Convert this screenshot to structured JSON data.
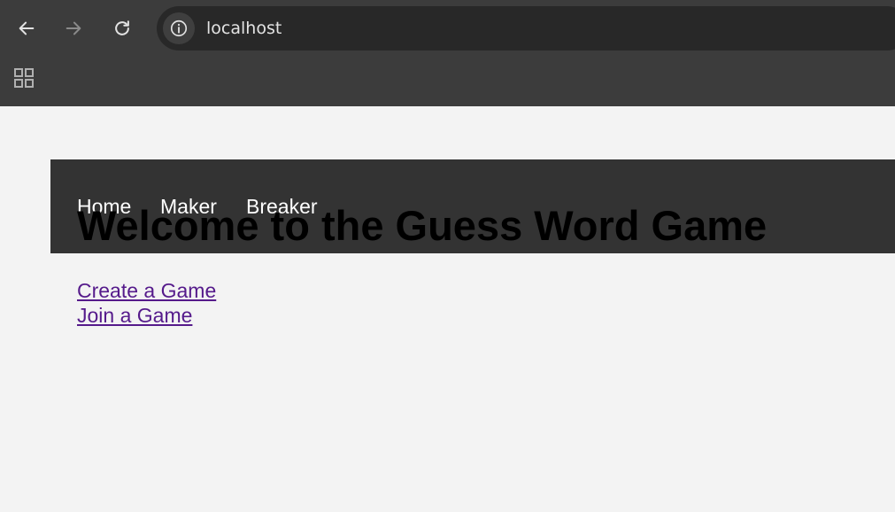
{
  "browser": {
    "url": "localhost",
    "icons": {
      "back": "back-arrow-icon",
      "forward": "forward-arrow-icon",
      "reload": "reload-icon",
      "site_info": "info-icon",
      "apps": "apps-grid-icon"
    }
  },
  "nav": {
    "items": [
      {
        "label": "Home"
      },
      {
        "label": "Maker"
      },
      {
        "label": "Breaker"
      }
    ]
  },
  "main": {
    "title": "Welcome to the Guess Word Game",
    "links": [
      {
        "label": "Create a Game"
      },
      {
        "label": "Join a Game"
      }
    ]
  },
  "colors": {
    "page_bg": "#f3f3f3",
    "nav_bg": "#333333",
    "visited_link": "#551a8b",
    "browser_chrome": "#3c3c3c"
  }
}
